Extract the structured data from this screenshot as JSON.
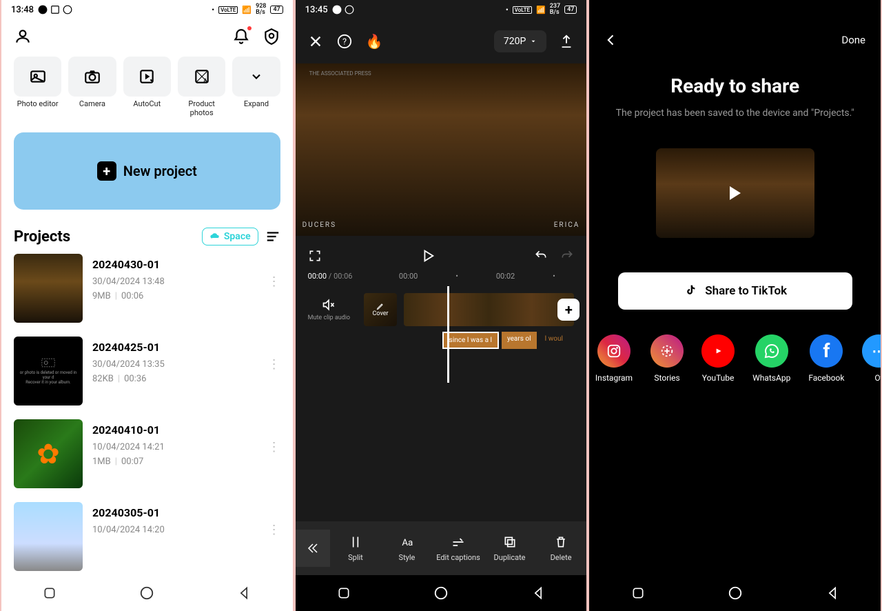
{
  "phone1": {
    "status": {
      "time": "13:48",
      "net": "928",
      "netUnit": "B/s",
      "battery": "47"
    },
    "tools": [
      {
        "label": "Photo editor"
      },
      {
        "label": "Camera"
      },
      {
        "label": "AutoCut"
      },
      {
        "label": "Product photos"
      },
      {
        "label": "Expand"
      }
    ],
    "newProject": "New project",
    "projectsTitle": "Projects",
    "spaceBtn": "Space",
    "projects": [
      {
        "name": "20240430-01",
        "date": "30/04/2024 13:48",
        "size": "9MB",
        "duration": "00:06"
      },
      {
        "name": "20240425-01",
        "date": "30/04/2024 13:35",
        "size": "82KB",
        "duration": "00:36"
      },
      {
        "name": "20240410-01",
        "date": "10/04/2024 14:21",
        "size": "1MB",
        "duration": "00:07"
      },
      {
        "name": "20240305-01",
        "date": "10/04/2024 14:20",
        "size": "",
        "duration": ""
      }
    ],
    "deletedText": "or photo is deleted or moved in your d\nRecover it in your album."
  },
  "phone2": {
    "status": {
      "time": "13:45",
      "net": "237",
      "netUnit": "B/s",
      "battery": "47"
    },
    "quality": "720P",
    "previewWatermark": "THE ASSOCIATED PRESS",
    "previewLeft": "DUCERS",
    "previewRight": "ERICA",
    "time": {
      "current": "00:00",
      "total": "00:06",
      "mark1": "00:00",
      "mark2": "00:02"
    },
    "muteLabel": "Mute clip audio",
    "coverLabel": "Cover",
    "captions": [
      "since I was a l",
      "years ol",
      "I woul"
    ],
    "editTools": [
      "Split",
      "Style",
      "Edit captions",
      "Duplicate",
      "Delete"
    ]
  },
  "phone3": {
    "done": "Done",
    "title": "Ready to share",
    "subtitle": "The project has been saved to the device and \"Projects.\"",
    "tiktokBtn": "Share to TikTok",
    "shareIcons": [
      "Instagram",
      "Stories",
      "YouTube",
      "WhatsApp",
      "Facebook",
      "Ot"
    ]
  }
}
